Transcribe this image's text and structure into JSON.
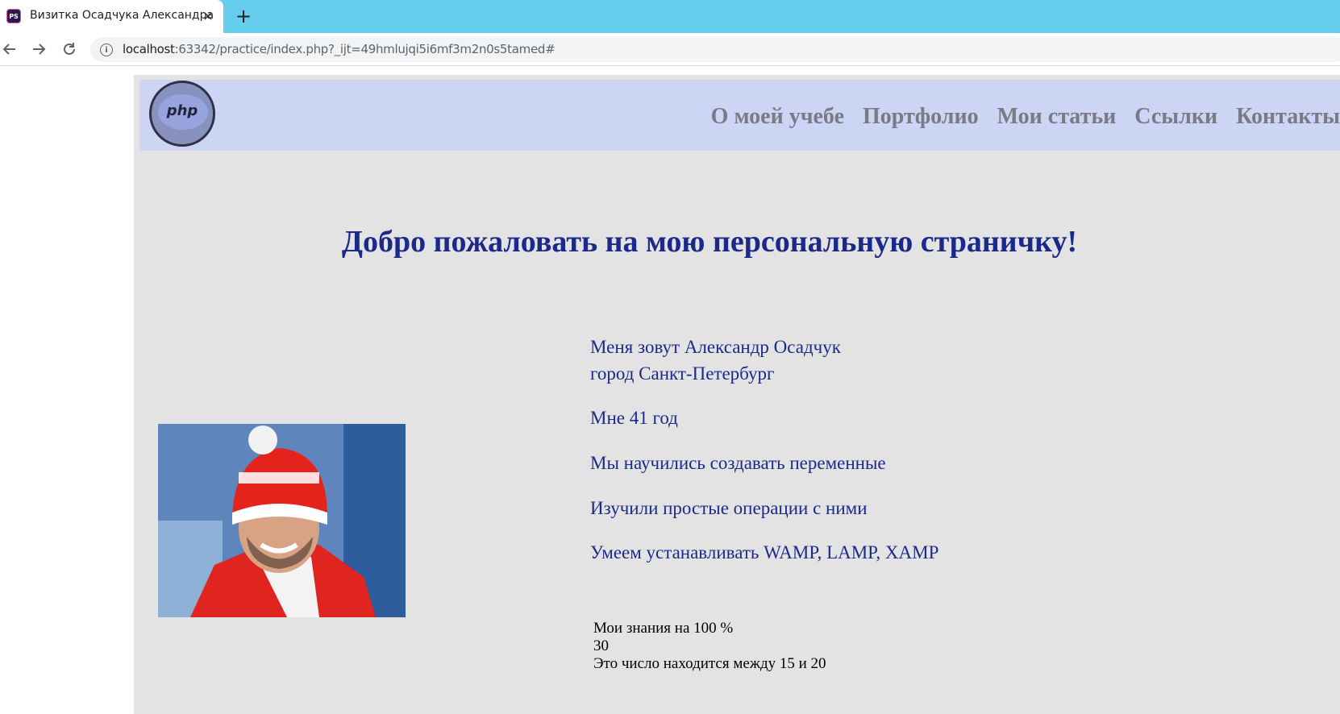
{
  "browser": {
    "tab": {
      "favicon_label": "PS",
      "title": "Визитка Осадчука Александра",
      "close_symbol": "×"
    },
    "new_tab_symbol": "+",
    "url_host": "localhost",
    "url_path": ":63342/practice/index.php?_ijt=49hmlujqi5i6mf3m2n0s5tamed#"
  },
  "header": {
    "logo_text": "php",
    "nav": [
      "О моей учебе",
      "Портфолио",
      "Мои статьи",
      "Ссылки",
      "Контакты"
    ]
  },
  "main": {
    "welcome": "Добро пожаловать на мою персональную страничку!",
    "info_lines": [
      "Меня зовут Александр Осадчук",
      "город Санкт-Петербург",
      "Мне 41 год",
      "Мы научились создавать переменные",
      "Изучили простые операции с ними",
      "Умеем устанавливать WAMP, LAMP, XAMP"
    ],
    "knowledge_lines": [
      "Мои знания на 100 %",
      "30",
      "Это число находится между 15 и 20"
    ]
  },
  "colors": {
    "tabbar": "#67cdee",
    "header_bg": "#ccd5f3",
    "page_bg": "#e3e3e3",
    "heading": "#1b2a8a",
    "nav_text": "#7a7a86"
  }
}
